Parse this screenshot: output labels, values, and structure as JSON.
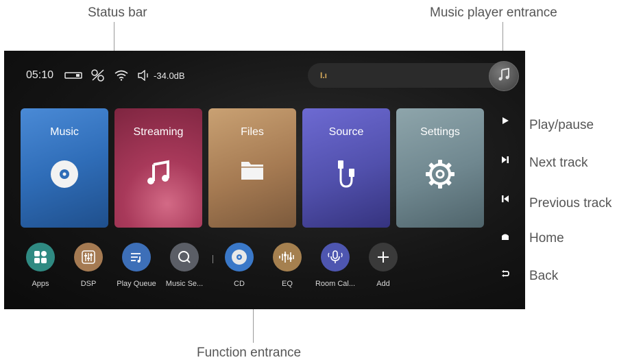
{
  "callouts": {
    "status_bar": "Status bar",
    "music_player_entrance": "Music player entrance",
    "function_entrance": "Function entrance",
    "play_pause": "Play/pause",
    "next_track": "Next track",
    "previous_track": "Previous track",
    "home": "Home",
    "back": "Back"
  },
  "status": {
    "time": "05:10",
    "volume": "-34.0dB",
    "icons": [
      "usb-device-icon",
      "output-off-icon",
      "wifi-icon",
      "speaker-icon"
    ]
  },
  "mini_player": {
    "bars_glyph": "I.ı",
    "icon": "music-note-icon"
  },
  "tiles": [
    {
      "label": "Music",
      "icon": "disc-icon",
      "color": "#3a78c8"
    },
    {
      "label": "Streaming",
      "icon": "music-note-icon",
      "color": "#b0405e"
    },
    {
      "label": "Files",
      "icon": "folder-icon",
      "color": "#b58a5c"
    },
    {
      "label": "Source",
      "icon": "cable-icon",
      "color": "#5a58b8"
    },
    {
      "label": "Settings",
      "icon": "gear-icon",
      "color": "#6f878f"
    }
  ],
  "apps": [
    {
      "label": "Apps",
      "icon": "grid-icon",
      "color": "#2f8a82"
    },
    {
      "label": "DSP",
      "icon": "sliders-icon",
      "color": "#a57a52"
    },
    {
      "label": "Play Queue",
      "icon": "queue-icon",
      "color": "#3d6fb8"
    },
    {
      "label": "Music Se...",
      "icon": "search-icon",
      "color": "#5b5e66"
    },
    {
      "label": "CD",
      "icon": "disc-icon",
      "color": "#3a78c8"
    },
    {
      "label": "EQ",
      "icon": "equalizer-icon",
      "color": "#a5804f"
    },
    {
      "label": "Room Cal...",
      "icon": "microphone-icon",
      "color": "#4e56b0"
    },
    {
      "label": "Add",
      "icon": "plus-icon",
      "color": "#3a3a3a"
    }
  ],
  "side_controls": [
    "play-icon",
    "next-track-icon",
    "previous-track-icon",
    "home-icon",
    "back-icon"
  ]
}
